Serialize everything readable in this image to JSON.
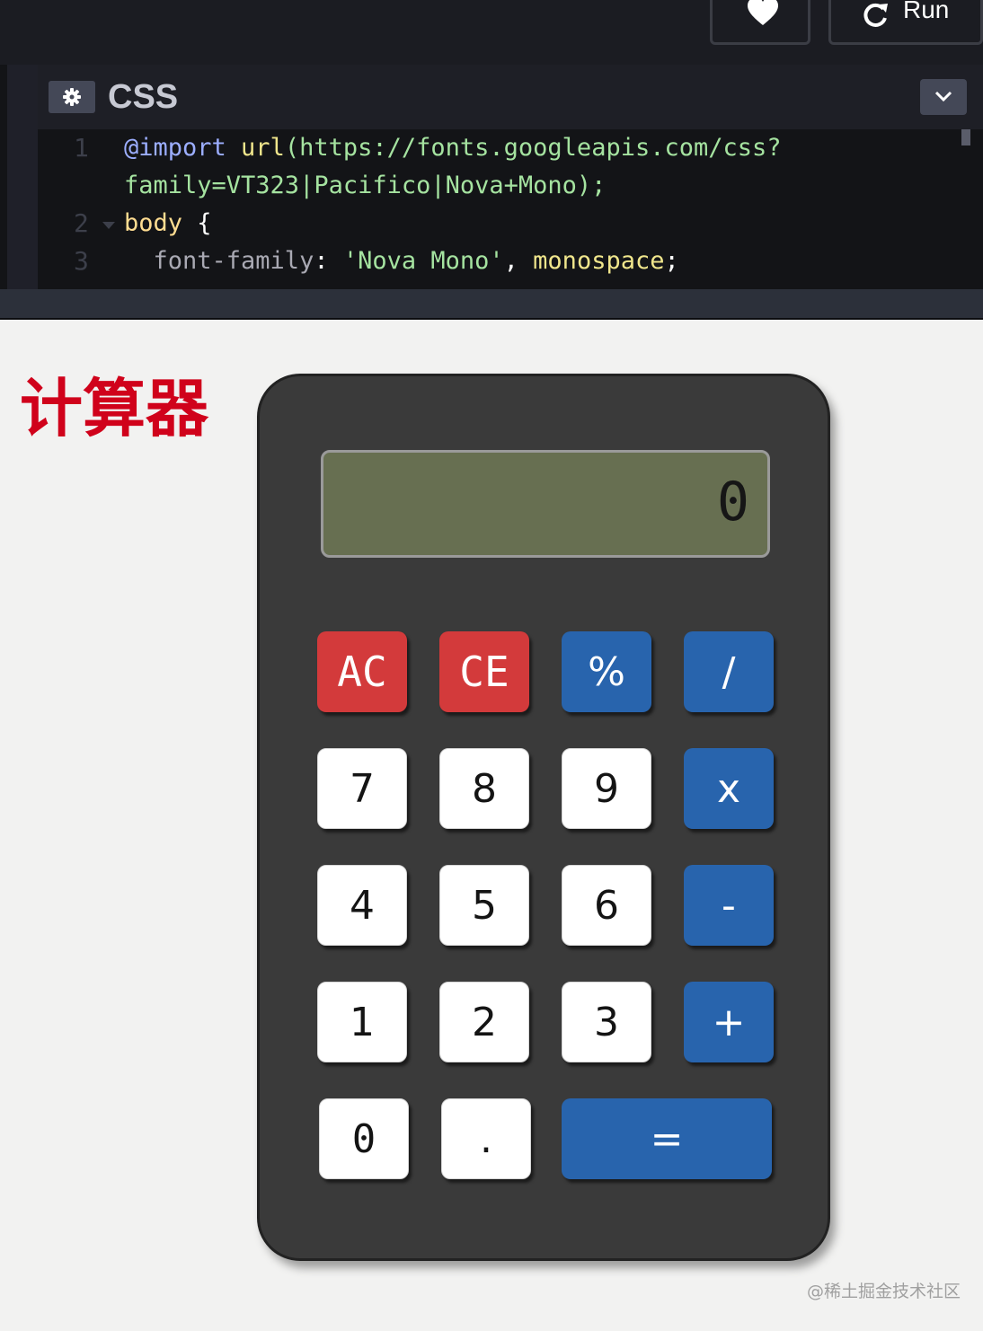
{
  "toolbar": {
    "run_label": "Run"
  },
  "editor": {
    "panel_title": "CSS",
    "line_numbers": [
      "1",
      "2",
      "3"
    ],
    "code": {
      "l1a_at": "@import",
      "l1a_fn": " url",
      "l1a_rest": "(https://fonts.googleapis.com/css?",
      "l1b": "family=VT323|Pacifico|Nova+Mono);",
      "l2_sel": "body",
      "l2_brace": " {",
      "l3_prop": "  font-family",
      "l3_colon": ": ",
      "l3_str": "'Nova Mono'",
      "l3_comma": ", ",
      "l3_kw": "monospace",
      "l3_semi": ";"
    }
  },
  "page": {
    "heading": "计算器"
  },
  "calculator": {
    "display": "0",
    "keys": {
      "ac": "AC",
      "ce": "CE",
      "percent": "%",
      "divide": "/",
      "seven": "7",
      "eight": "8",
      "nine": "9",
      "multiply": "x",
      "four": "4",
      "five": "5",
      "six": "6",
      "minus": "-",
      "one": "1",
      "two": "2",
      "three": "3",
      "plus": "+",
      "zero": "0",
      "decimal": ".",
      "equals": "="
    }
  },
  "watermark": "@稀土掘金技术社区",
  "icons": {
    "heart": "heart-icon",
    "run": "refresh-icon",
    "settings": "gear-icon",
    "collapse": "chevron-down-icon"
  },
  "colors": {
    "key_red": "#d33a3b",
    "key_blue": "#2864ad",
    "display_bg": "#676f51",
    "heading": "#d0021b",
    "calculator_body": "#3a3a3a"
  }
}
